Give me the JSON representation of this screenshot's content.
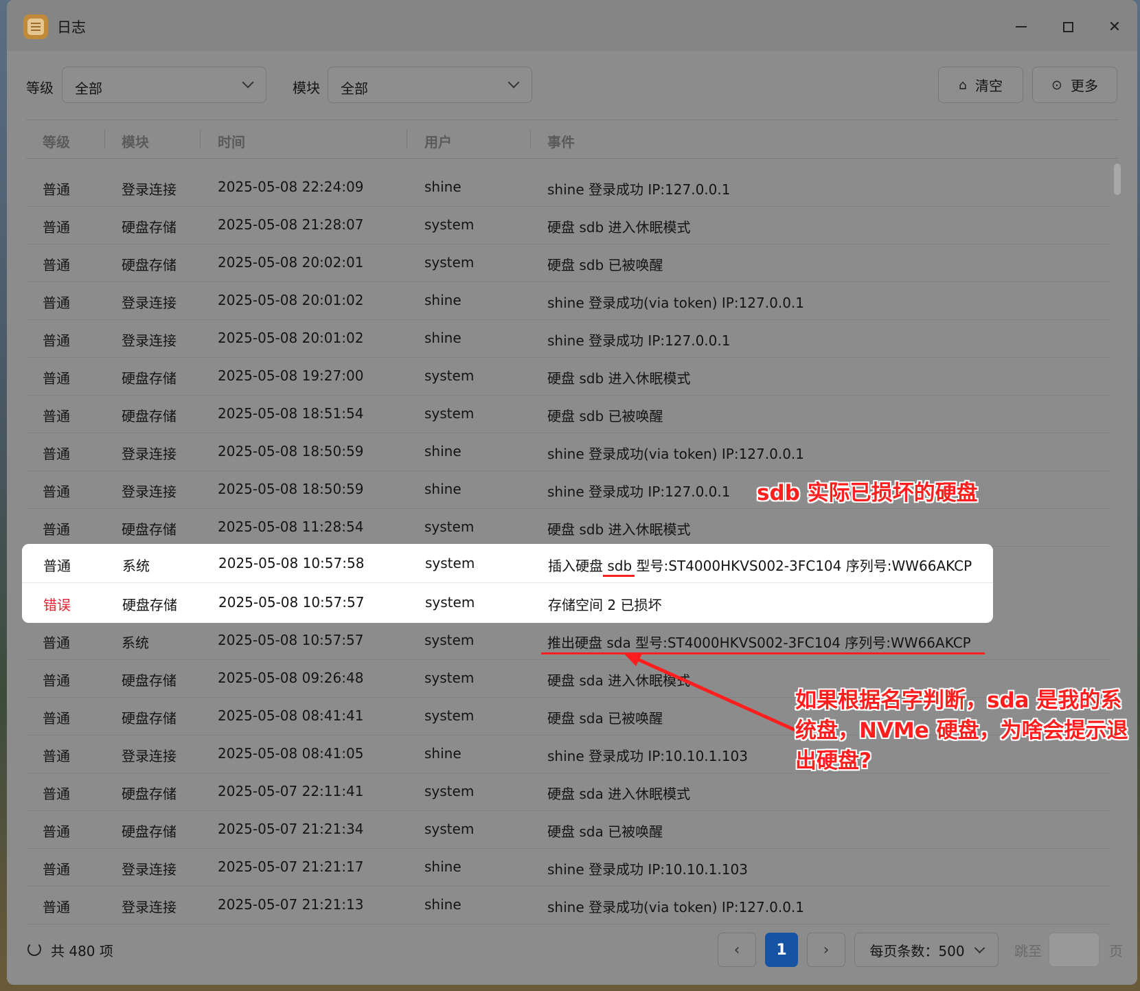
{
  "window": {
    "title": "日志"
  },
  "filters": {
    "level_label": "等级",
    "level_value": "全部",
    "module_label": "模块",
    "module_value": "全部"
  },
  "toolbar": {
    "clear_label": "清空",
    "more_label": "更多"
  },
  "table": {
    "headers": [
      "等级",
      "模块",
      "时间",
      "用户",
      "事件"
    ],
    "rows": [
      {
        "level": "普通",
        "module": "登录连接",
        "time": "2025-05-08 22:24:09",
        "user": "shine",
        "event": "shine 登录成功 IP:127.0.0.1"
      },
      {
        "level": "普通",
        "module": "硬盘存储",
        "time": "2025-05-08 21:28:07",
        "user": "system",
        "event": "硬盘 sdb 进入休眠模式"
      },
      {
        "level": "普通",
        "module": "硬盘存储",
        "time": "2025-05-08 20:02:01",
        "user": "system",
        "event": "硬盘 sdb 已被唤醒"
      },
      {
        "level": "普通",
        "module": "登录连接",
        "time": "2025-05-08 20:01:02",
        "user": "shine",
        "event": "shine 登录成功(via token) IP:127.0.0.1"
      },
      {
        "level": "普通",
        "module": "登录连接",
        "time": "2025-05-08 20:01:02",
        "user": "shine",
        "event": "shine 登录成功 IP:127.0.0.1"
      },
      {
        "level": "普通",
        "module": "硬盘存储",
        "time": "2025-05-08 19:27:00",
        "user": "system",
        "event": "硬盘 sdb 进入休眠模式"
      },
      {
        "level": "普通",
        "module": "硬盘存储",
        "time": "2025-05-08 18:51:54",
        "user": "system",
        "event": "硬盘 sdb 已被唤醒"
      },
      {
        "level": "普通",
        "module": "登录连接",
        "time": "2025-05-08 18:50:59",
        "user": "shine",
        "event": "shine 登录成功(via token) IP:127.0.0.1"
      },
      {
        "level": "普通",
        "module": "登录连接",
        "time": "2025-05-08 18:50:59",
        "user": "shine",
        "event": "shine 登录成功 IP:127.0.0.1"
      },
      {
        "level": "普通",
        "module": "硬盘存储",
        "time": "2025-05-08 11:28:54",
        "user": "system",
        "event": "硬盘 sdb 进入休眠模式"
      },
      {
        "level": "普通",
        "module": "系统",
        "time": "2025-05-08 10:57:58",
        "user": "system",
        "event": "插入硬盘 sdb 型号:ST4000HKVS002-3FC104 序列号:WW66AKCP"
      },
      {
        "level": "错误",
        "module": "硬盘存储",
        "time": "2025-05-08 10:57:57",
        "user": "system",
        "event": "存储空间 2 已损坏"
      },
      {
        "level": "普通",
        "module": "系统",
        "time": "2025-05-08 10:57:57",
        "user": "system",
        "event": "推出硬盘 sda 型号:ST4000HKVS002-3FC104 序列号:WW66AKCP"
      },
      {
        "level": "普通",
        "module": "硬盘存储",
        "time": "2025-05-08 09:26:48",
        "user": "system",
        "event": "硬盘 sda 进入休眠模式"
      },
      {
        "level": "普通",
        "module": "硬盘存储",
        "time": "2025-05-08 08:41:41",
        "user": "system",
        "event": "硬盘 sda 已被唤醒"
      },
      {
        "level": "普通",
        "module": "登录连接",
        "time": "2025-05-08 08:41:05",
        "user": "shine",
        "event": "shine 登录成功 IP:10.10.1.103"
      },
      {
        "level": "普通",
        "module": "硬盘存储",
        "time": "2025-05-07 22:11:41",
        "user": "system",
        "event": "硬盘 sda 进入休眠模式"
      },
      {
        "level": "普通",
        "module": "硬盘存储",
        "time": "2025-05-07 21:21:34",
        "user": "system",
        "event": "硬盘 sda 已被唤醒"
      },
      {
        "level": "普通",
        "module": "登录连接",
        "time": "2025-05-07 21:21:17",
        "user": "shine",
        "event": "shine 登录成功 IP:10.10.1.103"
      },
      {
        "level": "普通",
        "module": "登录连接",
        "time": "2025-05-07 21:21:13",
        "user": "shine",
        "event": "shine 登录成功(via token) IP:127.0.0.1"
      }
    ]
  },
  "footer": {
    "total": "共 480 项",
    "current_page": "1",
    "page_size": "每页条数：500",
    "jump_label": "跳至",
    "page_label": "页"
  },
  "annotations": {
    "note1": "sdb 实际已损坏的硬盘",
    "note2": "如果根据名字判断，sda 是我的系统盘，NVMe 硬盘，为啥会提示退出硬盘?"
  },
  "colors": {
    "error": "#e0242f",
    "accent": "#1553a3",
    "annotation": "#ff1e1e"
  }
}
